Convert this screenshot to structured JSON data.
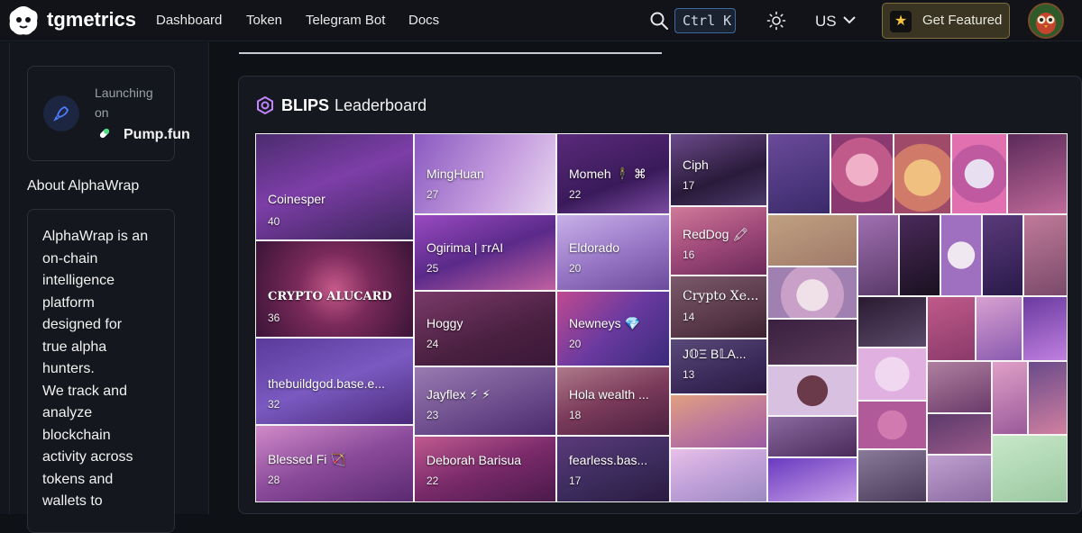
{
  "brand": {
    "name": "tgmetrics"
  },
  "nav": [
    "Dashboard",
    "Token",
    "Telegram Bot",
    "Docs"
  ],
  "search": {
    "shortcut": "Ctrl K"
  },
  "language": "US",
  "featured_label": "Get Featured",
  "launch": {
    "label": "Launching on",
    "platform": "Pump.fun"
  },
  "about": {
    "title": "About AlphaWrap",
    "text": "AlphaWrap is an\non-chain\nintelligence\nplatform\ndesigned for\ntrue alpha\nhunters.\nWe track and\nanalyze\nblockchain\nactivity across\ntokens and\nwallets to"
  },
  "leaderboard": {
    "brand": "BLIPS",
    "title": "Leaderboard",
    "tiles": [
      {
        "name": "Coinesper",
        "count": "40"
      },
      {
        "name": "CRYPTO ALUCARD",
        "count": "36"
      },
      {
        "name": "thebuildgod.base.e...",
        "count": "32"
      },
      {
        "name": "Blessed Fi 🏹",
        "count": "28"
      },
      {
        "name": "MingHuan",
        "count": "27"
      },
      {
        "name": "Ogirima | 𝕣rAI",
        "count": "25"
      },
      {
        "name": "Hoggy",
        "count": "24"
      },
      {
        "name": "Jayflex ⚡ ⚡",
        "count": "23"
      },
      {
        "name": "Deborah Barisua",
        "count": "22"
      },
      {
        "name": "Momeh 🕴 ⌘",
        "count": "22"
      },
      {
        "name": "Eldorado",
        "count": "20"
      },
      {
        "name": "Newneys 💎",
        "count": "20"
      },
      {
        "name": "Hola wealth ...",
        "count": "18"
      },
      {
        "name": "fearless.bas...",
        "count": "17"
      },
      {
        "name": "Ciph",
        "count": "17"
      },
      {
        "name": "RedDog 🖍",
        "count": "16"
      },
      {
        "name": "Crypto Xe...",
        "count": "14"
      },
      {
        "name": "J𝕆Ξ B𝕃A...",
        "count": "13"
      }
    ]
  },
  "colors": {
    "accent": "#a855f7",
    "featured_bg": "#3a3522",
    "star": "#f4c542"
  }
}
